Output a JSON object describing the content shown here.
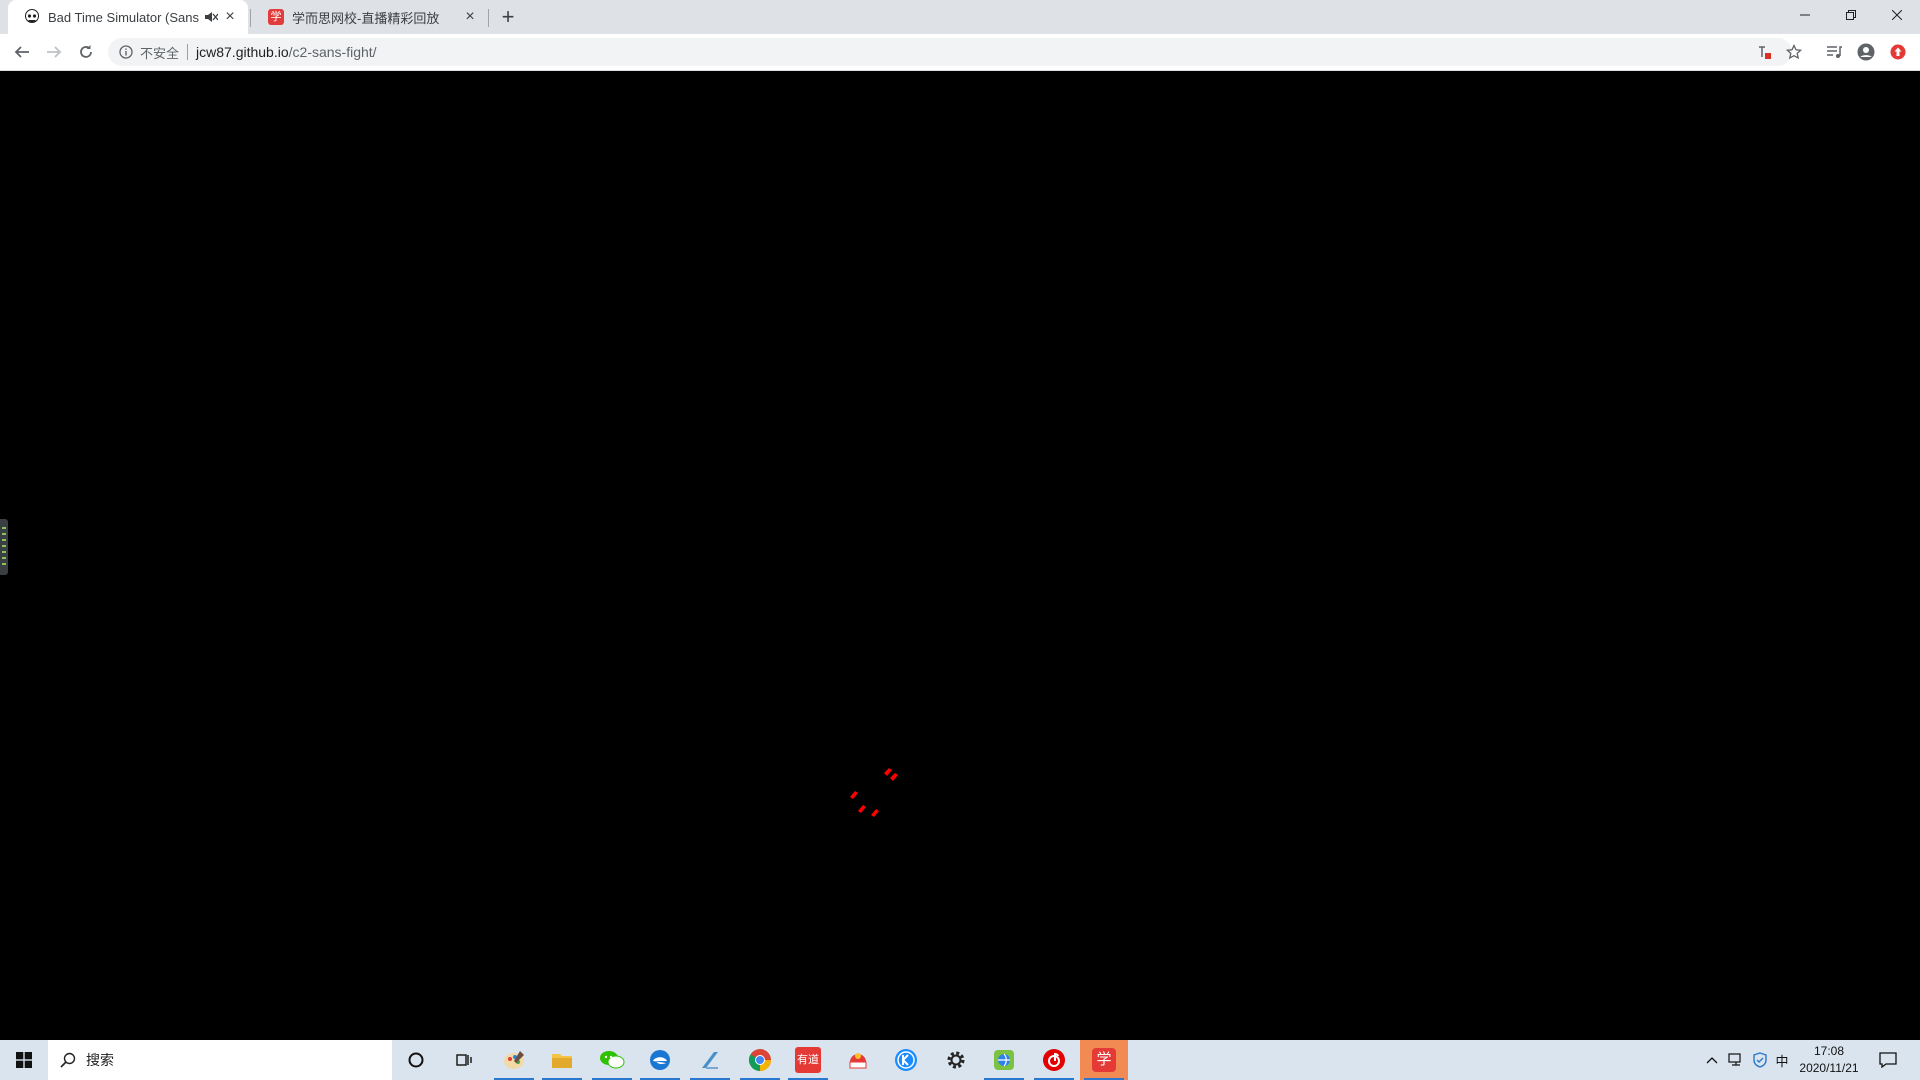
{
  "browser": {
    "tabs": [
      {
        "title": "Bad Time Simulator (Sans",
        "favicon": "skull-icon",
        "active": true,
        "muted": true
      },
      {
        "title": "学而思网校-直播精彩回放",
        "favicon": "xue-icon",
        "active": false,
        "favicon_text": "学"
      }
    ],
    "new_tab_label": "+",
    "address": {
      "security_label": "不安全",
      "host": "jcw87.github.io",
      "path": "/c2-sans-fight/"
    }
  },
  "game": {
    "soul_color": "#ff0000",
    "background": "#000000"
  },
  "taskbar": {
    "search_placeholder": "搜索",
    "pinned_apps": [
      {
        "name": "cortana-icon",
        "running": false
      },
      {
        "name": "task-view-icon",
        "running": false
      },
      {
        "name": "paint-icon",
        "running": true
      },
      {
        "name": "file-explorer-icon",
        "running": true
      },
      {
        "name": "wechat-icon",
        "running": true
      },
      {
        "name": "edge-icon",
        "running": true
      },
      {
        "name": "notepad-icon",
        "running": true
      },
      {
        "name": "chrome-icon",
        "running": true
      },
      {
        "name": "youdao-icon",
        "running": true,
        "label": "有道"
      },
      {
        "name": "red-app-icon",
        "running": false
      },
      {
        "name": "kugou-icon",
        "running": false
      },
      {
        "name": "settings-icon",
        "running": false
      },
      {
        "name": "globe-app-icon",
        "running": true
      },
      {
        "name": "netease-music-icon",
        "running": true
      },
      {
        "name": "xueersi-icon",
        "running": true,
        "label": "学"
      }
    ],
    "ime_label": "中",
    "time": "17:08",
    "date": "2020/11/21"
  }
}
